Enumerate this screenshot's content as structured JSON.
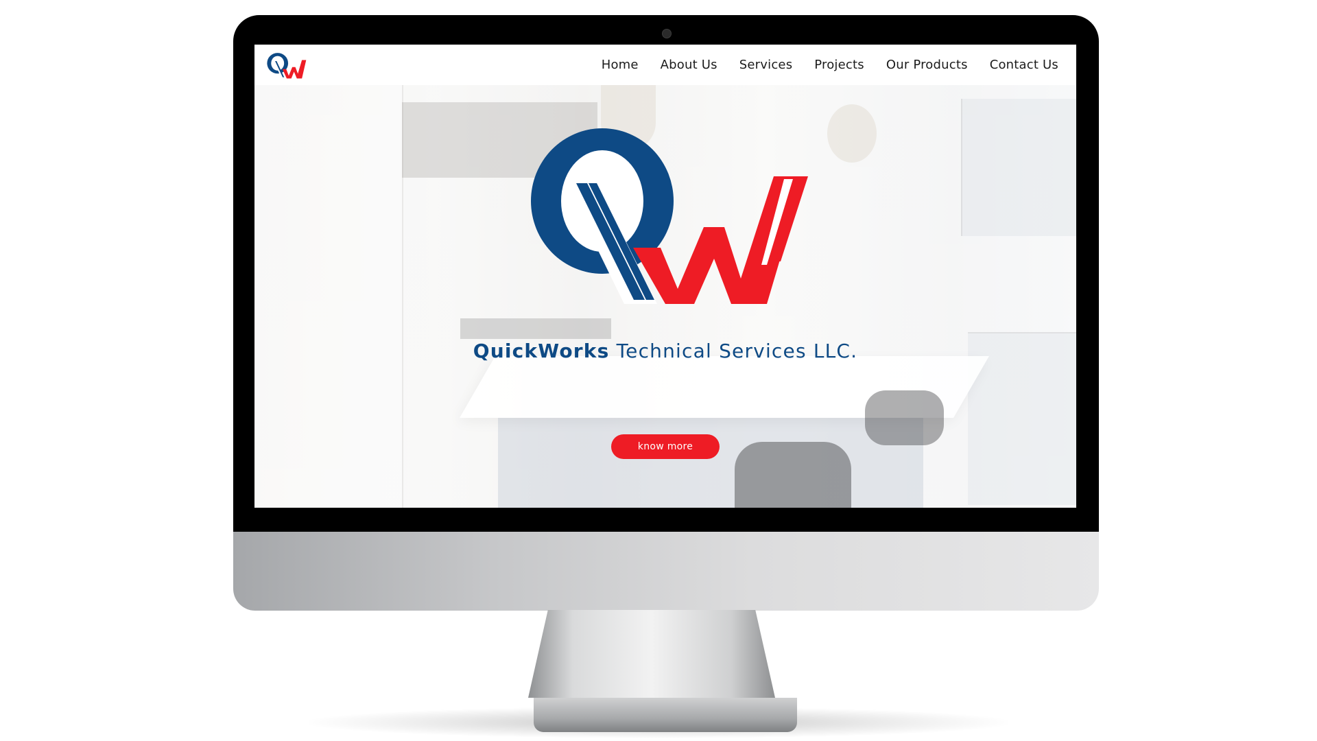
{
  "brand": {
    "logo_letters": "QW",
    "name_bold": "QuickWorks",
    "name_regular": "Technical Services LLC.",
    "colors": {
      "blue": "#0e4a85",
      "red": "#ee1c25"
    }
  },
  "nav": {
    "items": [
      {
        "label": "Home"
      },
      {
        "label": "About Us"
      },
      {
        "label": "Services"
      },
      {
        "label": "Projects"
      },
      {
        "label": "Our Products"
      },
      {
        "label": "Contact Us"
      }
    ]
  },
  "hero": {
    "cta_label": "know more",
    "background": "kitchen-interior-photo"
  }
}
